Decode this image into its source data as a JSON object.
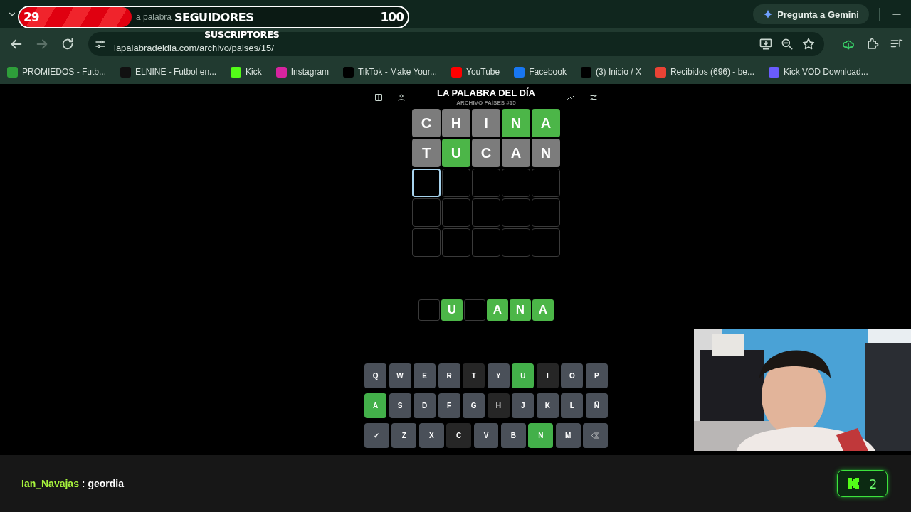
{
  "overlay": {
    "goal": {
      "current": "29",
      "label": "SEGUIDORES",
      "target": "100",
      "level": 0.29
    },
    "secondary_label": "SUSCRIPTORES"
  },
  "browser": {
    "tab_title": "a palabra",
    "gemini_button": "Pregunta a Gemini",
    "url": "lapalabradeldia.com/archivo/paises/15/",
    "bookmarks": [
      {
        "label": "PROMIEDOS - Futb...",
        "color": "#2e9e3a"
      },
      {
        "label": "ELNINE - Futbol en...",
        "color": "#111111"
      },
      {
        "label": "Kick",
        "color": "#53fc18"
      },
      {
        "label": "Instagram",
        "color": "#d6249f"
      },
      {
        "label": "TikTok - Make Your...",
        "color": "#000000"
      },
      {
        "label": "YouTube",
        "color": "#ff0000"
      },
      {
        "label": "Facebook",
        "color": "#1877f2"
      },
      {
        "label": "(3) Inicio / X",
        "color": "#000000"
      },
      {
        "label": "Recibidos (696) - be...",
        "color": "#ea4335"
      },
      {
        "label": "Kick VOD Download...",
        "color": "#6a5cff"
      }
    ]
  },
  "game": {
    "title": "LA PALABRA DEL DÍA",
    "subtitle": "ARCHIVO PAÍSES #15",
    "board": [
      [
        {
          "letter": "C",
          "correct": false
        },
        {
          "letter": "H",
          "correct": false
        },
        {
          "letter": "I",
          "correct": false
        },
        {
          "letter": "N",
          "correct": true
        },
        {
          "letter": "A",
          "correct": true
        }
      ],
      [
        {
          "letter": "T",
          "correct": false
        },
        {
          "letter": "U",
          "correct": true
        },
        {
          "letter": "C",
          "correct": false
        },
        {
          "letter": "A",
          "correct": false
        },
        {
          "letter": "N",
          "correct": false
        }
      ],
      [
        {
          "active": true
        },
        {
          "active": false
        },
        {
          "active": false
        },
        {
          "active": false
        },
        {
          "active": false
        }
      ],
      [
        {
          "active": false
        },
        {
          "active": false
        },
        {
          "active": false
        },
        {
          "active": false
        },
        {
          "active": false
        }
      ],
      [
        {
          "active": false
        },
        {
          "active": false
        },
        {
          "active": false
        },
        {
          "active": false
        },
        {
          "active": false
        }
      ]
    ],
    "answer": [
      {
        "revealed": false
      },
      {
        "letter": "U",
        "revealed": true
      },
      {
        "revealed": false
      },
      {
        "letter": "A",
        "revealed": true
      },
      {
        "letter": "N",
        "revealed": true
      },
      {
        "letter": "A",
        "revealed": true
      }
    ],
    "keyboard": [
      [
        {
          "kind": "letter",
          "label": "Q",
          "used": false,
          "correct": false
        },
        {
          "kind": "letter",
          "label": "W",
          "used": false,
          "correct": false
        },
        {
          "kind": "letter",
          "label": "E",
          "used": false,
          "correct": false
        },
        {
          "kind": "letter",
          "label": "R",
          "used": false,
          "correct": false
        },
        {
          "kind": "letter",
          "label": "T",
          "used": true,
          "correct": false
        },
        {
          "kind": "letter",
          "label": "Y",
          "used": false,
          "correct": false
        },
        {
          "kind": "letter",
          "label": "U",
          "correct": true
        },
        {
          "kind": "letter",
          "label": "I",
          "used": true,
          "correct": false
        },
        {
          "kind": "letter",
          "label": "O",
          "used": false,
          "correct": false
        },
        {
          "kind": "letter",
          "label": "P",
          "used": false,
          "correct": false
        }
      ],
      [
        {
          "kind": "letter",
          "label": "A",
          "correct": true
        },
        {
          "kind": "letter",
          "label": "S",
          "used": false,
          "correct": false
        },
        {
          "kind": "letter",
          "label": "D",
          "used": false,
          "correct": false
        },
        {
          "kind": "letter",
          "label": "F",
          "used": false,
          "correct": false
        },
        {
          "kind": "letter",
          "label": "G",
          "used": false,
          "correct": false
        },
        {
          "kind": "letter",
          "label": "H",
          "used": true,
          "correct": false
        },
        {
          "kind": "letter",
          "label": "J",
          "used": false,
          "correct": false
        },
        {
          "kind": "letter",
          "label": "K",
          "used": false,
          "correct": false
        },
        {
          "kind": "letter",
          "label": "L",
          "used": false,
          "correct": false
        },
        {
          "kind": "letter",
          "label": "Ñ",
          "used": false,
          "correct": false
        }
      ],
      [
        {
          "kind": "enter",
          "label": "✓"
        },
        {
          "kind": "letter",
          "label": "Z",
          "used": false,
          "correct": false
        },
        {
          "kind": "letter",
          "label": "X",
          "used": false,
          "correct": false
        },
        {
          "kind": "letter",
          "label": "C",
          "used": true,
          "correct": false
        },
        {
          "kind": "letter",
          "label": "V",
          "used": false,
          "correct": false
        },
        {
          "kind": "letter",
          "label": "B",
          "used": false,
          "correct": false
        },
        {
          "kind": "letter",
          "label": "N",
          "correct": true
        },
        {
          "kind": "letter",
          "label": "M",
          "used": false,
          "correct": false
        },
        {
          "kind": "backspace"
        }
      ]
    ]
  },
  "chat": {
    "messages": [
      {
        "user": "Ian_Navajas",
        "separator": ":",
        "text": "geordia"
      }
    ],
    "viewer_count": "2"
  }
}
